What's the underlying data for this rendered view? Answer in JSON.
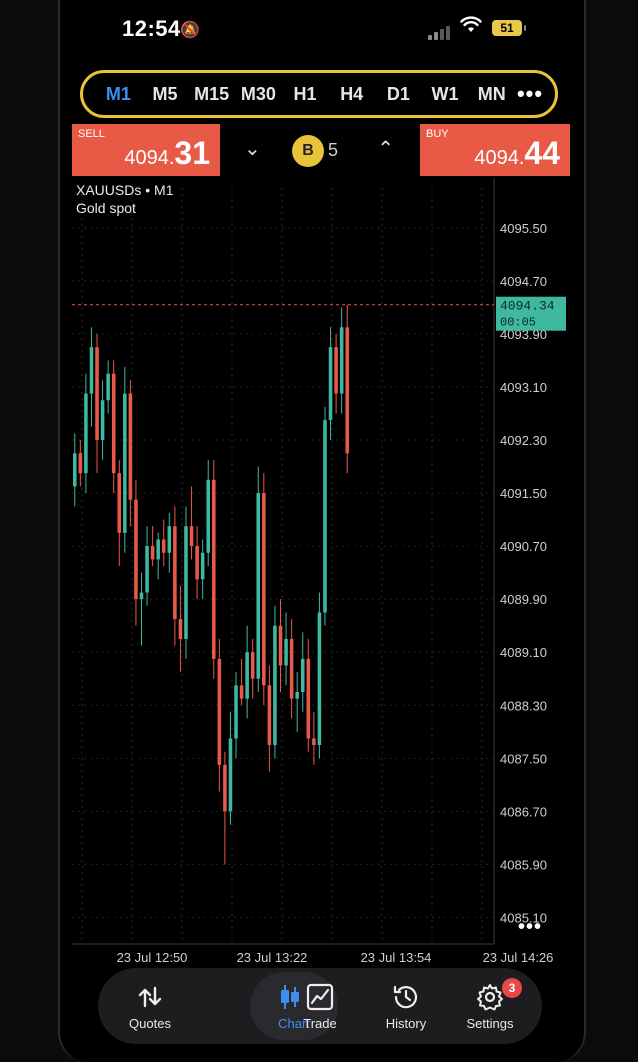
{
  "status": {
    "time": "12:54",
    "battery": "51"
  },
  "timeframes": [
    {
      "label": "M1",
      "active": true
    },
    {
      "label": "M5"
    },
    {
      "label": "M15"
    },
    {
      "label": "M30"
    },
    {
      "label": "H1"
    },
    {
      "label": "H4"
    },
    {
      "label": "D1"
    },
    {
      "label": "W1"
    },
    {
      "label": "MN"
    }
  ],
  "trade": {
    "sell_label": "SELL",
    "sell_small": "4094.",
    "sell_big": "31",
    "buy_label": "BUY",
    "buy_small": "4094.",
    "buy_big": "44",
    "badge": "B",
    "lot_fragment": "5"
  },
  "chart_header": {
    "symbol": "XAUUSDs • M1",
    "description": "Gold spot"
  },
  "chart_data": {
    "type": "candlestick",
    "y_ticks": [
      "4095.50",
      "4094.70",
      "4093.90",
      "4093.10",
      "4092.30",
      "4091.50",
      "4090.70",
      "4089.90",
      "4089.10",
      "4088.30",
      "4087.50",
      "4086.70",
      "4085.90",
      "4085.10"
    ],
    "ylim": [
      4084.7,
      4096.1
    ],
    "x_ticks": [
      "23 Jul 12:50",
      "23 Jul 13:22",
      "23 Jul 13:54",
      "23 Jul 14:26"
    ],
    "current_price": "4094.34",
    "countdown": "00:05",
    "price_line": 4094.34,
    "colors": {
      "up": "#3fb8a0",
      "down": "#e8594a",
      "price_tag": "#3fb8a0",
      "price_line": "#e8594a"
    },
    "candles": [
      [
        4091.6,
        4092.4,
        4091.3,
        4092.1
      ],
      [
        4092.1,
        4092.3,
        4091.6,
        4091.8
      ],
      [
        4091.8,
        4093.3,
        4091.5,
        4093.0
      ],
      [
        4093.0,
        4094.0,
        4092.5,
        4093.7
      ],
      [
        4093.7,
        4093.9,
        4091.8,
        4092.3
      ],
      [
        4092.3,
        4093.2,
        4092.0,
        4092.9
      ],
      [
        4092.9,
        4093.5,
        4092.7,
        4093.3
      ],
      [
        4093.3,
        4093.5,
        4091.5,
        4091.8
      ],
      [
        4091.8,
        4092.0,
        4090.4,
        4090.9
      ],
      [
        4090.9,
        4093.4,
        4090.6,
        4093.0
      ],
      [
        4093.0,
        4093.2,
        4091.0,
        4091.4
      ],
      [
        4091.4,
        4091.7,
        4089.5,
        4089.9
      ],
      [
        4089.9,
        4090.3,
        4089.2,
        4090.0
      ],
      [
        4090.0,
        4091.0,
        4089.8,
        4090.7
      ],
      [
        4090.7,
        4091.0,
        4090.4,
        4090.5
      ],
      [
        4090.5,
        4090.9,
        4090.2,
        4090.8
      ],
      [
        4090.8,
        4091.1,
        4090.4,
        4090.6
      ],
      [
        4090.6,
        4091.2,
        4090.3,
        4091.0
      ],
      [
        4091.0,
        4091.3,
        4089.2,
        4089.6
      ],
      [
        4089.6,
        4090.1,
        4088.8,
        4089.3
      ],
      [
        4089.3,
        4091.3,
        4089.0,
        4091.0
      ],
      [
        4091.0,
        4091.6,
        4090.5,
        4090.7
      ],
      [
        4090.7,
        4091.0,
        4089.9,
        4090.2
      ],
      [
        4090.2,
        4090.8,
        4089.9,
        4090.6
      ],
      [
        4090.6,
        4092.0,
        4090.4,
        4091.7
      ],
      [
        4091.7,
        4092.0,
        4088.7,
        4089.0
      ],
      [
        4089.0,
        4089.3,
        4087.0,
        4087.4
      ],
      [
        4087.4,
        4087.6,
        4085.9,
        4086.7
      ],
      [
        4086.7,
        4088.2,
        4086.5,
        4087.8
      ],
      [
        4087.8,
        4088.8,
        4087.5,
        4088.6
      ],
      [
        4088.6,
        4089.0,
        4088.3,
        4088.4
      ],
      [
        4088.4,
        4089.5,
        4088.1,
        4089.1
      ],
      [
        4089.1,
        4089.3,
        4088.4,
        4088.7
      ],
      [
        4088.7,
        4091.9,
        4088.5,
        4091.5
      ],
      [
        4091.5,
        4091.8,
        4088.3,
        4088.6
      ],
      [
        4088.6,
        4088.9,
        4087.3,
        4087.7
      ],
      [
        4087.7,
        4089.8,
        4087.5,
        4089.5
      ],
      [
        4089.5,
        4089.9,
        4088.5,
        4088.9
      ],
      [
        4088.9,
        4089.7,
        4088.6,
        4089.3
      ],
      [
        4089.3,
        4089.6,
        4088.1,
        4088.4
      ],
      [
        4088.4,
        4088.8,
        4087.9,
        4088.5
      ],
      [
        4088.5,
        4089.4,
        4088.2,
        4089.0
      ],
      [
        4089.0,
        4089.3,
        4087.6,
        4087.8
      ],
      [
        4087.8,
        4088.2,
        4087.4,
        4087.7
      ],
      [
        4087.7,
        4090.0,
        4087.5,
        4089.7
      ],
      [
        4089.7,
        4092.8,
        4089.5,
        4092.6
      ],
      [
        4092.6,
        4094.0,
        4092.3,
        4093.7
      ],
      [
        4093.7,
        4093.9,
        4092.7,
        4093.0
      ],
      [
        4093.0,
        4094.3,
        4092.7,
        4094.0
      ],
      [
        4094.0,
        4094.34,
        4091.8,
        4092.1
      ]
    ]
  },
  "nav": [
    {
      "label": "Quotes"
    },
    {
      "label": "Chart",
      "active": true
    },
    {
      "label": "Trade"
    },
    {
      "label": "History"
    },
    {
      "label": "Settings",
      "badge": "3"
    }
  ]
}
